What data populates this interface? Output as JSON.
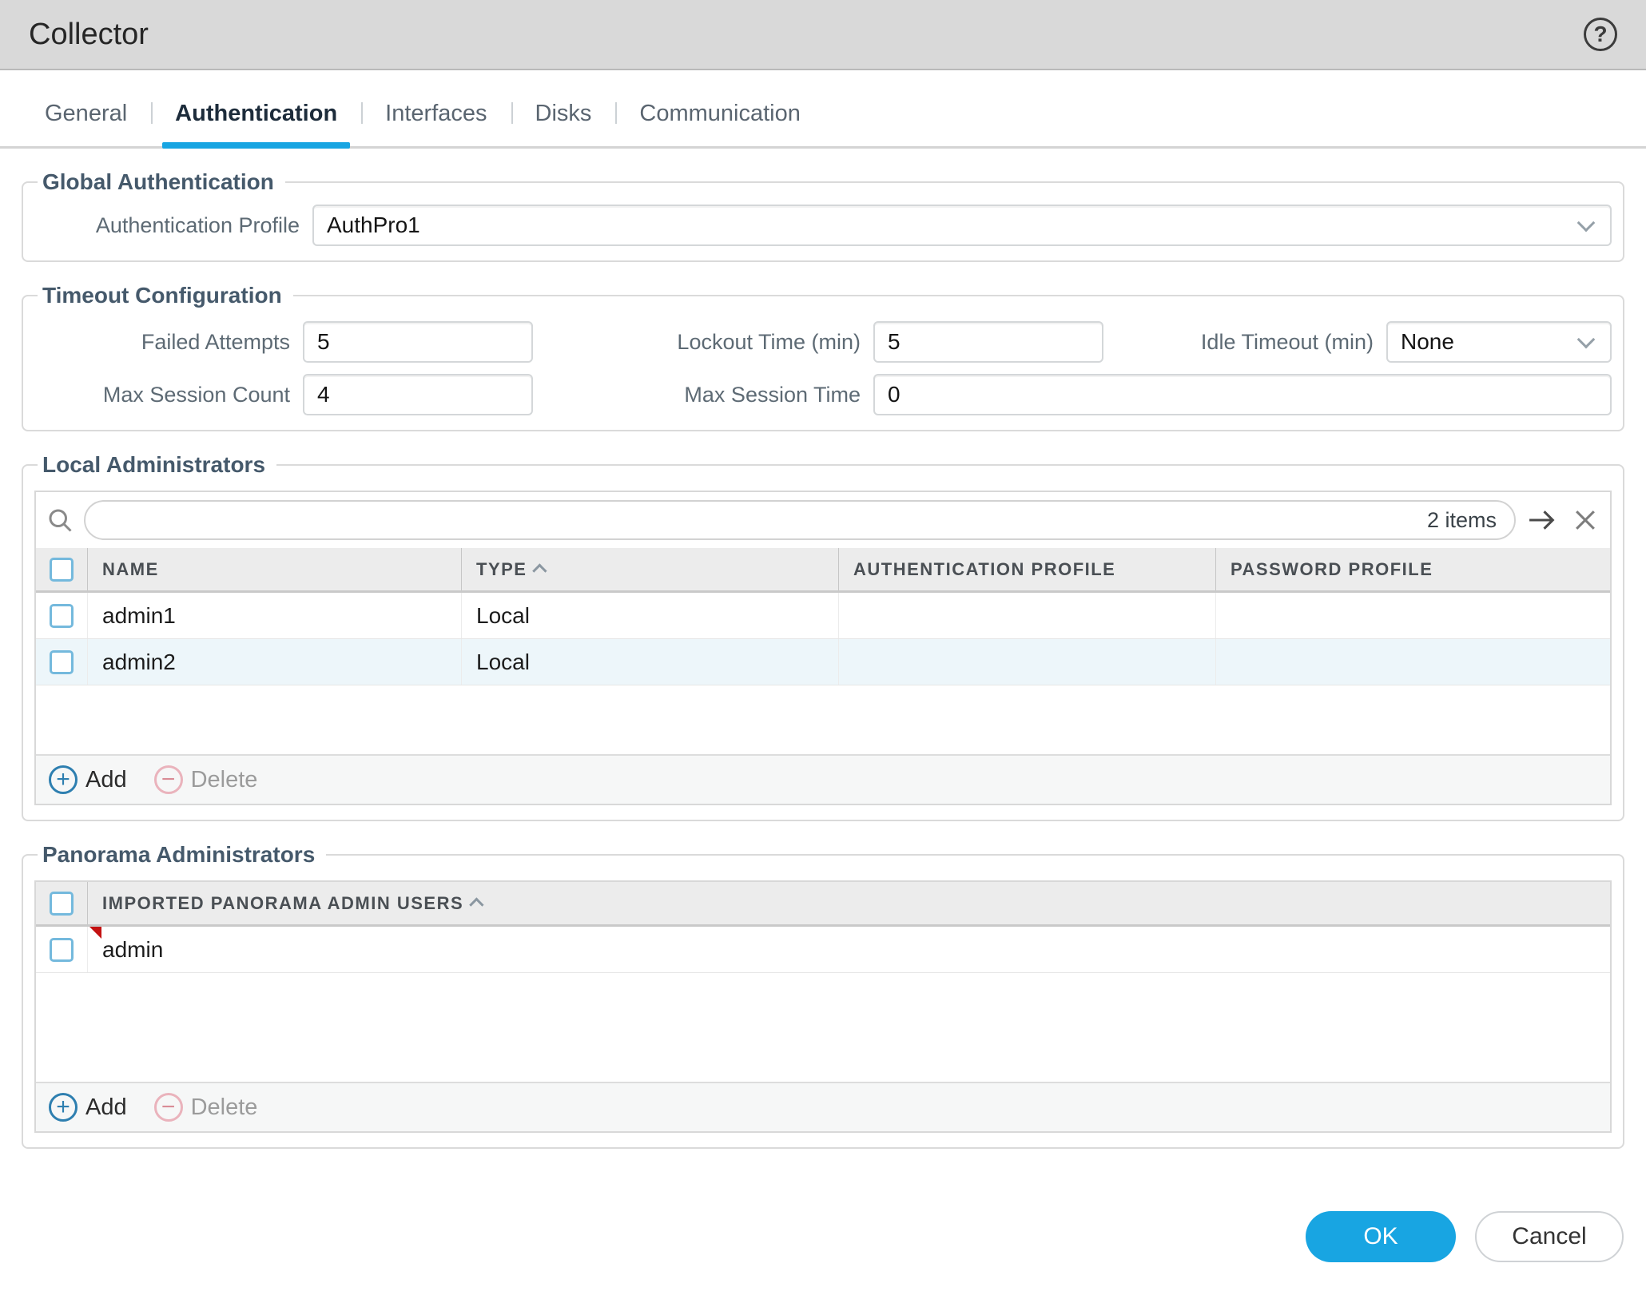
{
  "window": {
    "title": "Collector"
  },
  "tabs": [
    {
      "label": "General",
      "active": false
    },
    {
      "label": "Authentication",
      "active": true
    },
    {
      "label": "Interfaces",
      "active": false
    },
    {
      "label": "Disks",
      "active": false
    },
    {
      "label": "Communication",
      "active": false
    }
  ],
  "global_authentication": {
    "legend": "Global Authentication",
    "authentication_profile": {
      "label": "Authentication Profile",
      "value": "AuthPro1"
    }
  },
  "timeout_configuration": {
    "legend": "Timeout Configuration",
    "failed_attempts": {
      "label": "Failed Attempts",
      "value": "5"
    },
    "lockout_time": {
      "label": "Lockout Time (min)",
      "value": "5"
    },
    "idle_timeout": {
      "label": "Idle Timeout (min)",
      "value": "None"
    },
    "max_session_count": {
      "label": "Max Session Count",
      "value": "4"
    },
    "max_session_time": {
      "label": "Max Session Time",
      "value": "0"
    }
  },
  "local_administrators": {
    "legend": "Local Administrators",
    "toolbar": {
      "items_count": "2 items"
    },
    "columns": {
      "name": "NAME",
      "type": "TYPE",
      "authentication_profile": "AUTHENTICATION PROFILE",
      "password_profile": "PASSWORD PROFILE"
    },
    "rows": [
      {
        "name": "admin1",
        "type": "Local",
        "authentication_profile": "",
        "password_profile": ""
      },
      {
        "name": "admin2",
        "type": "Local",
        "authentication_profile": "",
        "password_profile": ""
      }
    ],
    "actions": {
      "add": "Add",
      "delete": "Delete"
    }
  },
  "panorama_administrators": {
    "legend": "Panorama Administrators",
    "columns": {
      "imported": "IMPORTED PANORAMA ADMIN USERS"
    },
    "rows": [
      {
        "name": "admin",
        "modified": true
      }
    ],
    "actions": {
      "add": "Add",
      "delete": "Delete"
    }
  },
  "dialog_actions": {
    "ok": "OK",
    "cancel": "Cancel"
  },
  "colors": {
    "accent": "#18a5e2",
    "titlebar_bg": "#d9d9d9",
    "legend": "#45596b",
    "row_alt": "#edf6fa",
    "modified_marker": "#c41212"
  }
}
